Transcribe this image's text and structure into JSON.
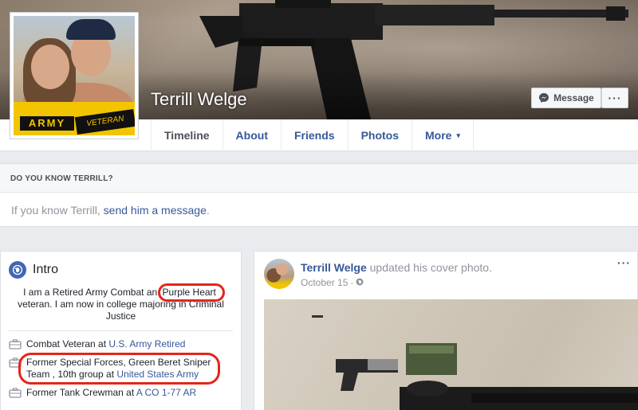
{
  "profile": {
    "name": "Terrill Welge",
    "avatar_badge_left": "ARMY",
    "avatar_badge_right": "VETERAN"
  },
  "actions": {
    "message_label": "Message",
    "more_label": "···"
  },
  "tabs": [
    {
      "label": "Timeline",
      "active": true
    },
    {
      "label": "About",
      "active": false
    },
    {
      "label": "Friends",
      "active": false
    },
    {
      "label": "Photos",
      "active": false
    },
    {
      "label": "More",
      "active": false,
      "caret": "▾"
    }
  ],
  "know": {
    "heading": "DO YOU KNOW TERRILL?",
    "text_before": "If you know Terrill, ",
    "link": "send him a message",
    "text_after": "."
  },
  "intro": {
    "title": "Intro",
    "bio_part1": "I am a Retired Army Combat an ",
    "bio_highlight": "Purple Heart",
    "bio_part2": " veteran. I am now in college majoring in Criminal Justice",
    "items": [
      {
        "prefix": "Combat Veteran at ",
        "link": "U.S. Army Retired",
        "circled": false
      },
      {
        "prefix": "Former Special Forces, Green Beret Sniper Team , 10th group at ",
        "link": "United States Army",
        "circled": true
      },
      {
        "prefix": "Former Tank Crewman at ",
        "link": "A CO 1-77 AR",
        "circled": false
      }
    ]
  },
  "post": {
    "author": "Terrill Welge",
    "action": " updated his cover photo.",
    "date": "October 15",
    "separator": "·",
    "privacy_icon": "globe-icon",
    "more": "···"
  },
  "colors": {
    "link": "#365899",
    "brand": "#4267b2",
    "highlight_circle": "#e4251a",
    "army_yellow": "#f2c500"
  }
}
